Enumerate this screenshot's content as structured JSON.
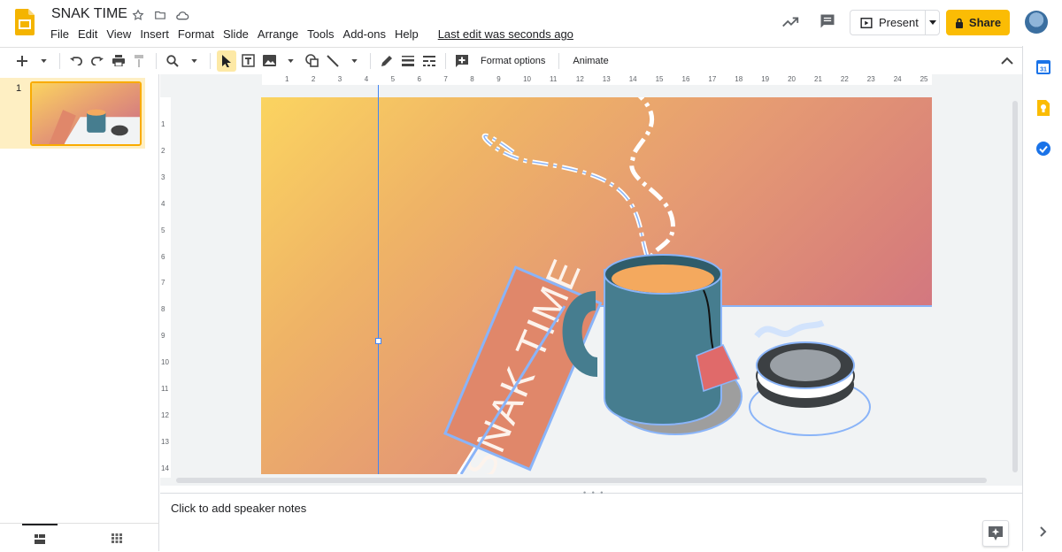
{
  "app": {
    "title": "SNAK TIME",
    "menu": [
      "File",
      "Edit",
      "View",
      "Insert",
      "Format",
      "Slide",
      "Arrange",
      "Tools",
      "Add-ons",
      "Help"
    ],
    "last_edit": "Last edit was seconds ago",
    "present_label": "Present",
    "share_label": "Share"
  },
  "toolbar": {
    "format_options": "Format options",
    "animate": "Animate",
    "icons": [
      "new-slide-icon",
      "undo-icon",
      "redo-icon",
      "print-icon",
      "paint-format-icon",
      "zoom-icon",
      "select-icon",
      "text-box-icon",
      "image-icon",
      "shape-icon",
      "line-icon",
      "pen-icon",
      "border-weight-icon",
      "border-dash-icon",
      "comment-add-icon"
    ]
  },
  "filmstrip": {
    "slide_number": "1"
  },
  "slide": {
    "book_text": "SNAK TIME"
  },
  "ruler": {
    "horizontal": [
      "1",
      "2",
      "3",
      "4",
      "5",
      "6",
      "7",
      "8",
      "9",
      "10",
      "11",
      "12",
      "13",
      "14",
      "15",
      "16",
      "17",
      "18",
      "19",
      "20",
      "21",
      "22",
      "23",
      "24",
      "25"
    ],
    "vertical": [
      "1",
      "2",
      "3",
      "4",
      "5",
      "6",
      "7",
      "8",
      "9",
      "10",
      "11",
      "12",
      "13",
      "14"
    ]
  },
  "notes": {
    "placeholder": "Click to add speaker notes"
  },
  "colors": {
    "accent": "#fbbc04",
    "mug": "#467d8f",
    "tea": "#f4a95e",
    "tag": "#e06a6a",
    "outline": "#8ab4f8"
  }
}
